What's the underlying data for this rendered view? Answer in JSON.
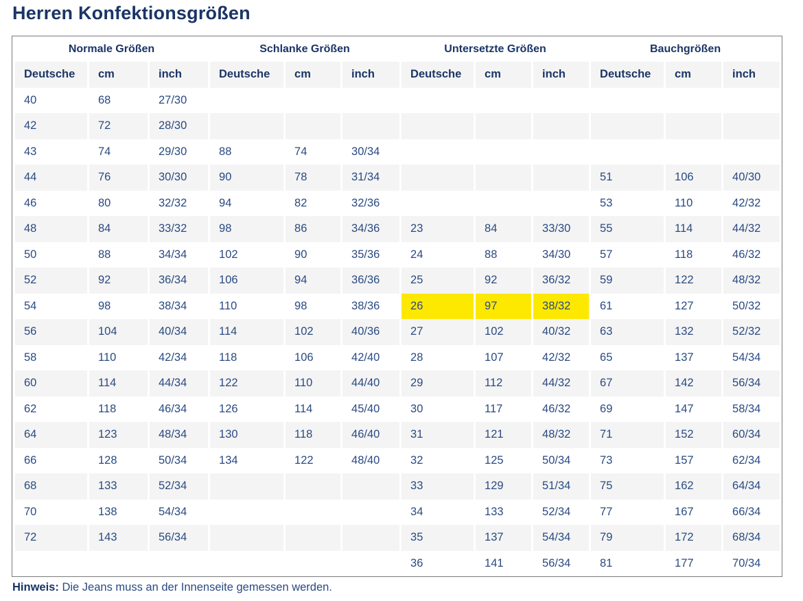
{
  "title": "Herren Konfektionsgrößen",
  "groups": [
    "Normale Größen",
    "Schlanke Größen",
    "Untersetzte Größen",
    "Bauchgrößen"
  ],
  "subheaders": [
    "Deutsche",
    "cm",
    "inch",
    "Deutsche",
    "cm",
    "inch",
    "Deutsche",
    "cm",
    "inch",
    "Deutsche",
    "cm",
    "inch"
  ],
  "rows": [
    [
      "40",
      "68",
      "27/30",
      "",
      "",
      "",
      "",
      "",
      "",
      "",
      "",
      ""
    ],
    [
      "42",
      "72",
      "28/30",
      "",
      "",
      "",
      "",
      "",
      "",
      "",
      "",
      ""
    ],
    [
      "43",
      "74",
      "29/30",
      "88",
      "74",
      "30/34",
      "",
      "",
      "",
      "",
      "",
      ""
    ],
    [
      "44",
      "76",
      "30/30",
      "90",
      "78",
      "31/34",
      "",
      "",
      "",
      "51",
      "106",
      "40/30"
    ],
    [
      "46",
      "80",
      "32/32",
      "94",
      "82",
      "32/36",
      "",
      "",
      "",
      "53",
      "110",
      "42/32"
    ],
    [
      "48",
      "84",
      "33/32",
      "98",
      "86",
      "34/36",
      "23",
      "84",
      "33/30",
      "55",
      "114",
      "44/32"
    ],
    [
      "50",
      "88",
      "34/34",
      "102",
      "90",
      "35/36",
      "24",
      "88",
      "34/30",
      "57",
      "118",
      "46/32"
    ],
    [
      "52",
      "92",
      "36/34",
      "106",
      "94",
      "36/36",
      "25",
      "92",
      "36/32",
      "59",
      "122",
      "48/32"
    ],
    [
      "54",
      "98",
      "38/34",
      "110",
      "98",
      "38/36",
      "26",
      "97",
      "38/32",
      "61",
      "127",
      "50/32"
    ],
    [
      "56",
      "104",
      "40/34",
      "114",
      "102",
      "40/36",
      "27",
      "102",
      "40/32",
      "63",
      "132",
      "52/32"
    ],
    [
      "58",
      "110",
      "42/34",
      "118",
      "106",
      "42/40",
      "28",
      "107",
      "42/32",
      "65",
      "137",
      "54/34"
    ],
    [
      "60",
      "114",
      "44/34",
      "122",
      "110",
      "44/40",
      "29",
      "112",
      "44/32",
      "67",
      "142",
      "56/34"
    ],
    [
      "62",
      "118",
      "46/34",
      "126",
      "114",
      "45/40",
      "30",
      "117",
      "46/32",
      "69",
      "147",
      "58/34"
    ],
    [
      "64",
      "123",
      "48/34",
      "130",
      "118",
      "46/40",
      "31",
      "121",
      "48/32",
      "71",
      "152",
      "60/34"
    ],
    [
      "66",
      "128",
      "50/34",
      "134",
      "122",
      "48/40",
      "32",
      "125",
      "50/34",
      "73",
      "157",
      "62/34"
    ],
    [
      "68",
      "133",
      "52/34",
      "",
      "",
      "",
      "33",
      "129",
      "51/34",
      "75",
      "162",
      "64/34"
    ],
    [
      "70",
      "138",
      "54/34",
      "",
      "",
      "",
      "34",
      "133",
      "52/34",
      "77",
      "167",
      "66/34"
    ],
    [
      "72",
      "143",
      "56/34",
      "",
      "",
      "",
      "35",
      "137",
      "54/34",
      "79",
      "172",
      "68/34"
    ],
    [
      "",
      "",
      "",
      "",
      "",
      "",
      "36",
      "141",
      "56/34",
      "81",
      "177",
      "70/34"
    ]
  ],
  "highlight": {
    "row": 8,
    "cols": [
      6,
      7,
      8
    ],
    "color": "#fde800"
  },
  "note": {
    "label": "Hinweis:",
    "text": " Die Jeans muss an der Innenseite gemessen werden."
  },
  "colors": {
    "heading": "#1a3566",
    "text": "#2a4a82",
    "stripe": "#f4f4f4",
    "highlight": "#fde800"
  }
}
